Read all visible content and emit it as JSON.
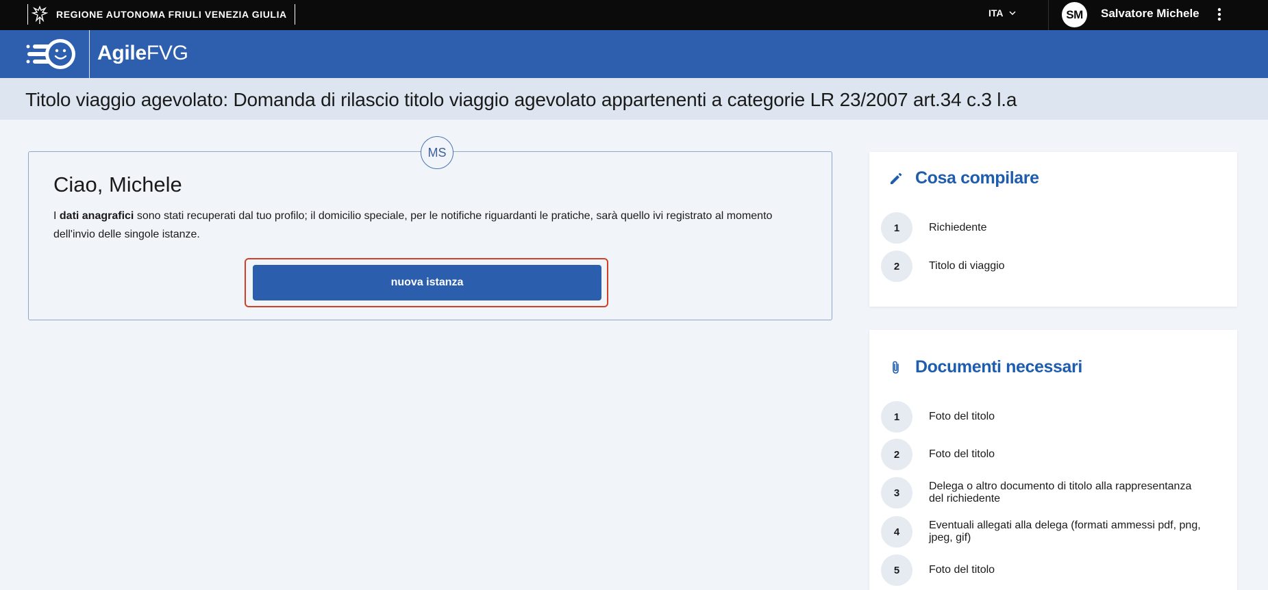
{
  "topbar": {
    "region_name": "REGIONE AUTONOMA FRIULI VENEZIA GIULIA",
    "language": "ITA",
    "user_initials": "SM",
    "user_name": "Salvatore Michele"
  },
  "brand": {
    "name_bold": "Agile",
    "name_light": "FVG"
  },
  "page": {
    "title": "Titolo viaggio agevolato: Domanda di rilascio titolo viaggio agevolato appartenenti a categorie LR 23/2007 art.34 c.3 l.a"
  },
  "welcome": {
    "badge": "MS",
    "greeting": "Ciao, Michele",
    "info_prefix": "I ",
    "info_bold": "dati anagrafici",
    "info_rest": " sono stati recuperati dal tuo profilo; il domicilio speciale, per le notifiche riguardanti le pratiche, sarà quello ivi registrato al momento dell'invio delle singole istanze.",
    "button_label": "nuova istanza"
  },
  "cosa_compilare": {
    "title": "Cosa compilare",
    "steps": [
      {
        "num": "1",
        "label": "Richiedente"
      },
      {
        "num": "2",
        "label": "Titolo di viaggio"
      }
    ]
  },
  "documenti": {
    "title": "Documenti necessari",
    "items": [
      {
        "num": "1",
        "label": "Foto del titolo"
      },
      {
        "num": "2",
        "label": "Foto del titolo"
      },
      {
        "num": "3",
        "label": "Delega o altro documento di titolo alla rappresentanza del richiedente"
      },
      {
        "num": "4",
        "label": "Eventuali allegati alla delega (formati ammessi pdf, png, jpeg, gif)"
      },
      {
        "num": "5",
        "label": "Foto del titolo"
      }
    ]
  },
  "colors": {
    "topbar": "#0b0b0b",
    "brand_blue": "#2d5fae",
    "accent_blue": "#1e5cad",
    "highlight_red": "#d23f25"
  }
}
